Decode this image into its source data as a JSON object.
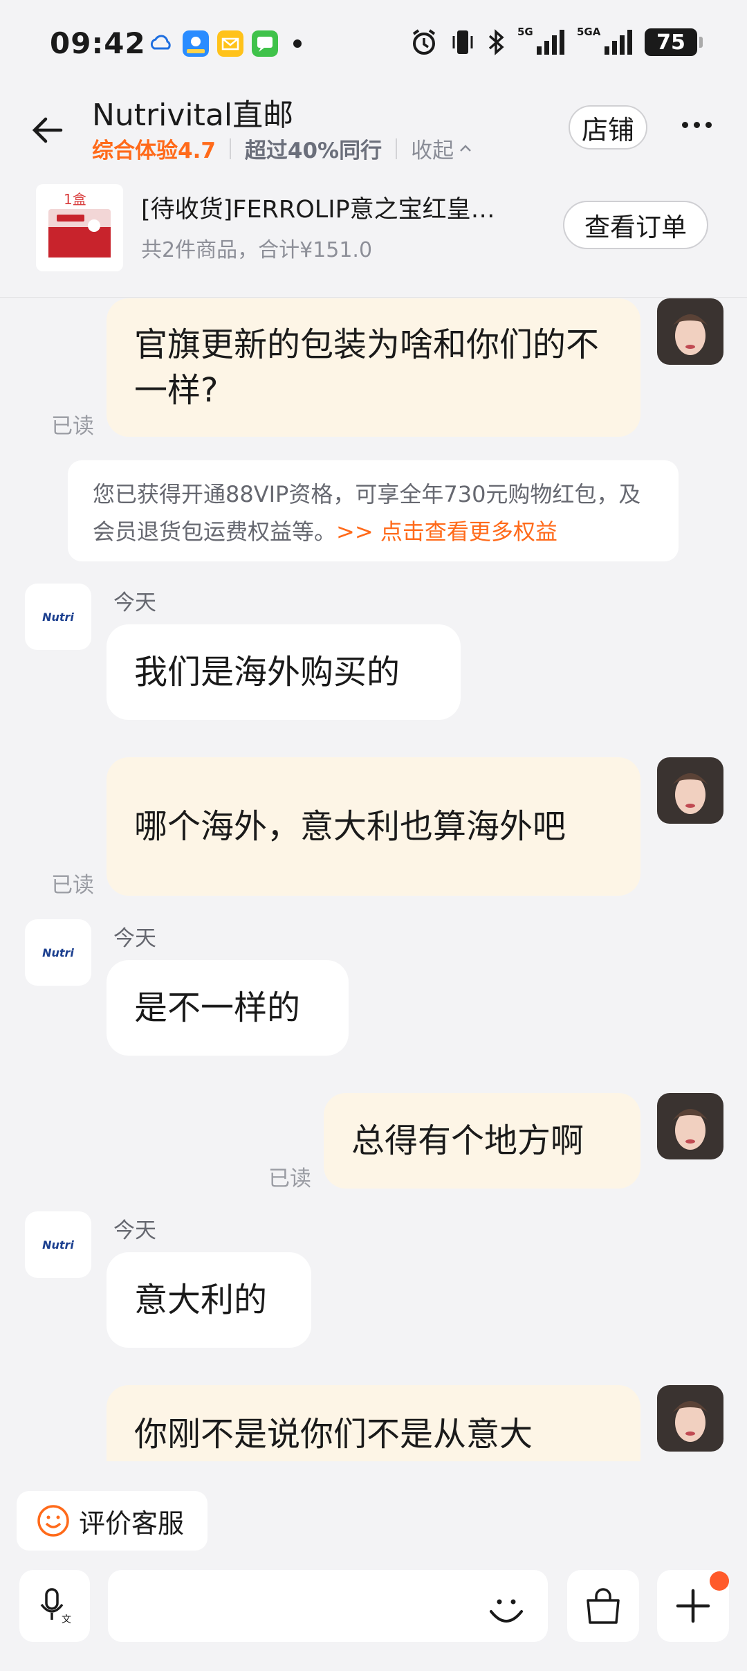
{
  "status_bar": {
    "time": "09:42",
    "battery": "75",
    "signal1_label": "5G",
    "signal2_label": "5GA"
  },
  "header": {
    "shop_name": "Nutrivital直邮",
    "score": "综合体验4.7",
    "peer_rank": "超过40%同行",
    "collapse": "收起",
    "store_button": "店铺"
  },
  "order": {
    "thumb_qty": "1盒",
    "title": "[待收货]FERROLIP意之宝红皇…",
    "summary": "共2件商品，合计¥151.0",
    "view_button": "查看订单"
  },
  "messages": [
    {
      "side": "out",
      "text": "官旗更新的包装为啥和你们的不一样?",
      "read": "已读"
    },
    {
      "side": "notice",
      "text": "您已获得开通88VIP资格，可享全年730元购物红包，及会员退货包运费权益等。",
      "link": ">> 点击查看更多权益"
    },
    {
      "side": "in",
      "day": "今天",
      "text": "我们是海外购买的"
    },
    {
      "side": "out",
      "text": "哪个海外，意大利也算海外吧",
      "read": "已读"
    },
    {
      "side": "in",
      "day": "今天",
      "text": "是不一样的"
    },
    {
      "side": "out",
      "text": "总得有个地方啊",
      "read": "已读"
    },
    {
      "side": "in",
      "day": "今天",
      "text": "意大利的"
    },
    {
      "side": "out",
      "text": "你刚不是说你们不是从意大"
    }
  ],
  "shop_avatar_text": "Nutri",
  "bottom": {
    "rate_button": "评价客服",
    "input_placeholder": ""
  },
  "colors": {
    "accent": "#ff6a1a",
    "outgoing_bubble": "#fdf5e6",
    "incoming_bubble": "#ffffff",
    "background": "#f3f3f5"
  }
}
